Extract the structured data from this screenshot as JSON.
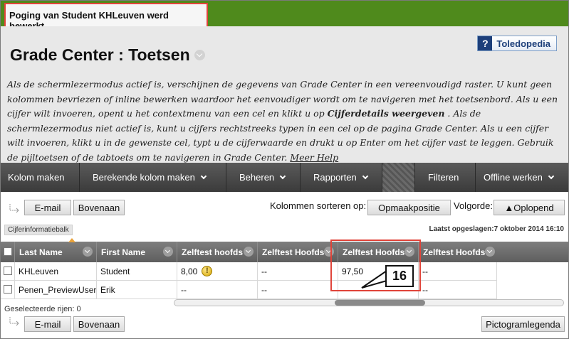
{
  "receipt": {
    "message": "Poging van Student KHLeuven werd bewerkt"
  },
  "header": {
    "title": "Grade Center : Toetsen",
    "help_label": "Toledopedia",
    "instructions": {
      "part1": "Als de schermlezermodus actief is, verschijnen de gegevens van Grade Center in een vereenvoudigd raster. U kunt geen kolommen bevriezen of inline bewerken waardoor het eenvoudiger wordt om te navigeren met het toetsenbord. Als u een cijfer wilt invoeren, opent u het contextmenu van een cel en klikt u op ",
      "bold": "Cijferdetails weergeven",
      "part2": " . Als de schermlezermodus niet actief is, kunt u cijfers rechtstreeks typen in een cel op de pagina Grade Center. Als u een cijfer wilt invoeren, klikt u in de gewenste cel, typt u de cijferwaarde en drukt u op Enter om het cijfer vast te leggen. Gebruik de pijltoetsen of de tabtoets om te navigeren in Grade Center. ",
      "link": "Meer Help"
    }
  },
  "actionbar": {
    "items": [
      {
        "label": "Kolom maken"
      },
      {
        "label": "Berekende kolom maken"
      },
      {
        "label": "Beheren"
      },
      {
        "label": "Rapporten"
      },
      {
        "label": "Filteren"
      },
      {
        "label": "Offline werken"
      }
    ]
  },
  "toolbar": {
    "email_label": "E-mail",
    "top_label": "Bovenaan",
    "sort_label": "Kolommen sorteren op:",
    "sort_value": "Opmaakpositie",
    "order_label": "Volgorde:",
    "order_value": "▲Oplopend"
  },
  "infobar": {
    "tab_label": "Cijferinformatiebalk",
    "saved": "Laatst opgeslagen:7 oktober 2014 16:10"
  },
  "grid": {
    "columns": [
      "Last Name",
      "First Name",
      "Zelftest hoofds",
      "Zelftest Hoofds",
      "Zelftest Hoofds",
      "Zelftest Hoofds"
    ],
    "rows": [
      [
        "KHLeuven",
        "Student",
        "8,00",
        "--",
        "97,50",
        "--"
      ],
      [
        "Penen_PreviewUser",
        "Erik",
        "--",
        "--",
        "--",
        "--"
      ]
    ],
    "warn_glyph": "!"
  },
  "footer": {
    "selected_rows": "Geselecteerde rijen: 0",
    "email_label": "E-mail",
    "top_label": "Bovenaan",
    "legend_label": "Pictogramlegenda"
  },
  "annotation": {
    "number": "16"
  }
}
